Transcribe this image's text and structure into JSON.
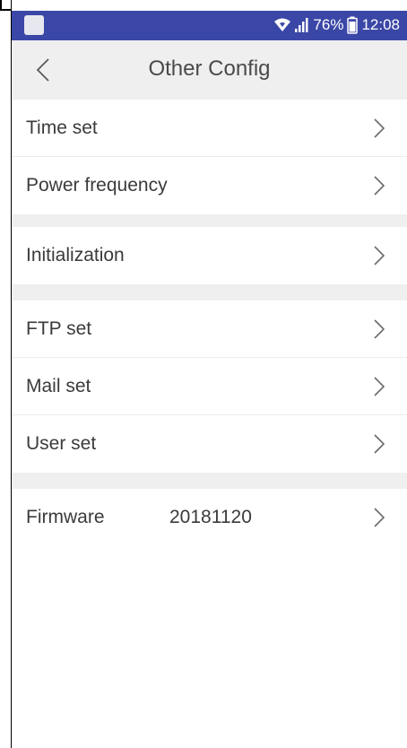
{
  "status_bar": {
    "battery": "76%",
    "time": "12:08",
    "icons": [
      "wifi-icon",
      "signal-icon",
      "battery-icon"
    ]
  },
  "header": {
    "title": "Other Config",
    "back_icon": "chevron-left-icon"
  },
  "sections": [
    {
      "items": [
        {
          "label": "Time set",
          "value": ""
        },
        {
          "label": "Power frequency",
          "value": ""
        }
      ]
    },
    {
      "items": [
        {
          "label": "Initialization",
          "value": ""
        }
      ]
    },
    {
      "items": [
        {
          "label": "FTP set",
          "value": ""
        },
        {
          "label": "Mail set",
          "value": ""
        },
        {
          "label": "User set",
          "value": ""
        }
      ]
    },
    {
      "items": [
        {
          "label": "Firmware",
          "value": "20181120"
        }
      ]
    }
  ],
  "colors": {
    "status_bar": "#3b47a6",
    "header_bg": "#efefef",
    "text": "#3b3b3b",
    "divider": "#ececec"
  }
}
